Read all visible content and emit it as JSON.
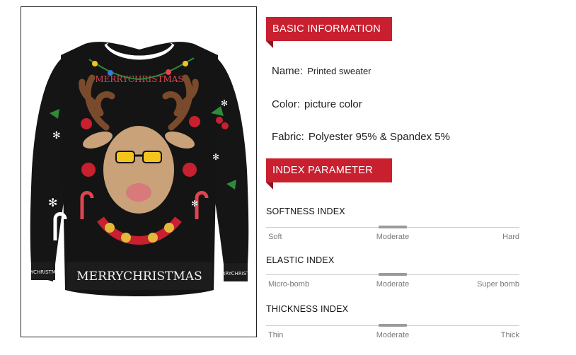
{
  "basic_section": {
    "title": "BASIC INFORMATION",
    "name": {
      "label": "Name:",
      "value": "Printed sweater"
    },
    "color": {
      "label": "Color:",
      "value": "picture color"
    },
    "fabric": {
      "label": "Fabric:",
      "value": "Polyester 95% & Spandex 5%"
    }
  },
  "index_section": {
    "title": "INDEX PARAMETER",
    "params": [
      {
        "title": "SOFTNESS INDEX",
        "low": "Soft",
        "mid": "Moderate",
        "high": "Hard",
        "level": 0.5
      },
      {
        "title": "ELASTIC INDEX",
        "low": "Micro-bomb",
        "mid": "Moderate",
        "high": "Super bomb",
        "level": 0.5
      },
      {
        "title": "THICKNESS INDEX",
        "low": "Thin",
        "mid": "Moderate",
        "high": "Thick",
        "level": 0.5
      }
    ]
  },
  "product_image": {
    "top_text": "MERRYCHRISTMAS",
    "hem_text": "MERRYCHRISTMAS",
    "left_cuff_text": "YCHRISTM",
    "right_cuff_text": "RRYCHRIST",
    "colors": {
      "sweater": "#141414",
      "accent": "#c8202f",
      "deer": "#c9a27a"
    }
  }
}
